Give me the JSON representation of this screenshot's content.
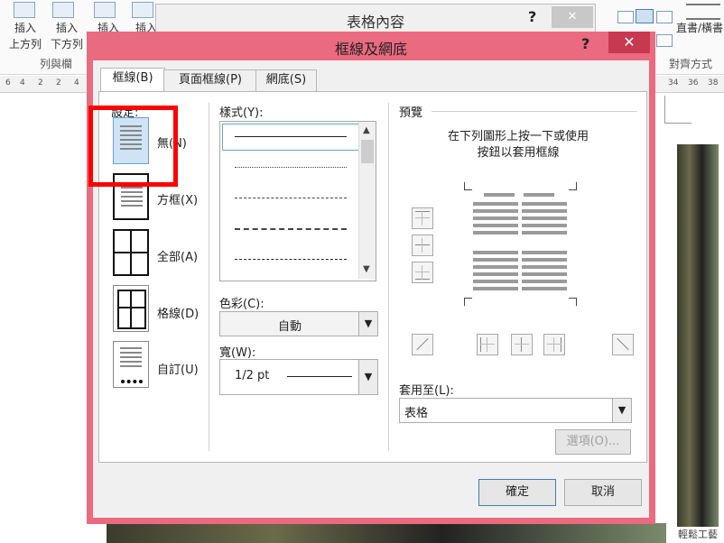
{
  "ribbon": {
    "insert_above_l1": "插入",
    "insert_above_l2": "上方列",
    "insert_below_l1": "插入",
    "insert_below_l2": "下方列",
    "insert_left": "插入",
    "insert_right": "插入",
    "group_rows_cols": "列與欄",
    "direction_label": "直書/橫書",
    "group_alignment": "對齊方式"
  },
  "ruler_left": [
    "6",
    "4",
    "2",
    "2",
    "4"
  ],
  "ruler_right": [
    "34",
    "36",
    "38"
  ],
  "back_dialog": {
    "title": "表格內容",
    "help": "?",
    "close": "✕"
  },
  "dialog": {
    "title": "框線及網底",
    "help": "?",
    "close": "✕",
    "tabs": [
      "框線(B)",
      "頁面框線(P)",
      "網底(S)"
    ],
    "settings_label": "設定:",
    "presets": [
      "無(N)",
      "方框(X)",
      "全部(A)",
      "格線(D)",
      "自訂(U)"
    ],
    "style_label": "樣式(Y):",
    "color_label": "色彩(C):",
    "color_value": "自動",
    "width_label": "寬(W):",
    "width_value": "1/2 pt",
    "preview_label": "預覽",
    "preview_hint_l1": "在下列圖形上按一下或使用",
    "preview_hint_l2": "按鈕以套用框線",
    "apply_to_label": "套用至(L):",
    "apply_to_value": "表格",
    "options_button": "選項(O)...",
    "ok_button": "確定",
    "cancel_button": "取消"
  },
  "colors": {
    "dialog_frame": "#ea6a80",
    "close_button": "#c8384e",
    "highlight": "#ff0000"
  },
  "watermark": "輕鬆工藝"
}
